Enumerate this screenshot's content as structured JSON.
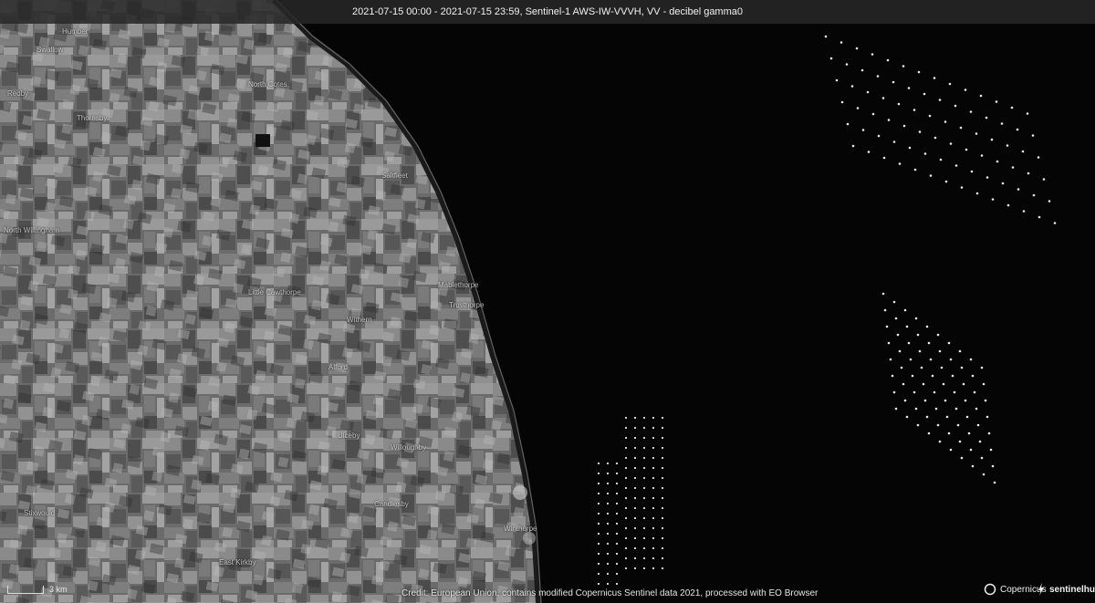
{
  "header": {
    "title": "2021-07-15 00:00 - 2021-07-15 23:59, Sentinel-1 AWS-IW-VVVH, VV - decibel gamma0"
  },
  "places": [
    {
      "name": "Humber"
    },
    {
      "name": "Swallow"
    },
    {
      "name": "Redby"
    },
    {
      "name": "North Cotes"
    },
    {
      "name": "Thoresby"
    },
    {
      "name": "Saltfleet"
    },
    {
      "name": "North Willingham"
    },
    {
      "name": "Little Cawthorpe"
    },
    {
      "name": "Mablethorpe"
    },
    {
      "name": "Trusthorpe"
    },
    {
      "name": "Withern"
    },
    {
      "name": "Alford"
    },
    {
      "name": "Ulceby"
    },
    {
      "name": "Willoughby"
    },
    {
      "name": "Stixwould"
    },
    {
      "name": "Candlesby"
    },
    {
      "name": "Winthorpe"
    },
    {
      "name": "East Kirkby"
    }
  ],
  "scale": {
    "label": "3 km"
  },
  "footer": {
    "credit": "Credit: European Union, contains modified Copernicus Sentinel data 2021, processed with EO Browser",
    "logo_copernicus": "Copernicus",
    "logo_sentinelhub": "sentinelhub"
  }
}
